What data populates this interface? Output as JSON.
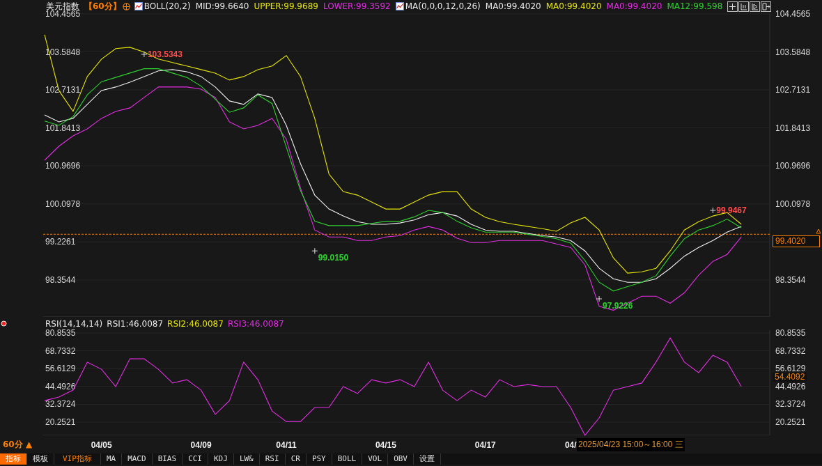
{
  "header": {
    "items": [
      {
        "kind": "title",
        "text": "美元指数",
        "color": "#e8e8e8"
      },
      {
        "kind": "period",
        "text": "【60分】",
        "color": "#ff8000"
      },
      {
        "kind": "add",
        "color": "#ff8000"
      },
      {
        "kind": "indicator",
        "text": "BOLL(20,2)",
        "color": "#e8e8e8"
      },
      {
        "kind": "value",
        "text": "MID:99.6640",
        "color": "#e8e8e8"
      },
      {
        "kind": "value",
        "text": "UPPER:99.9689",
        "color": "#e6e600"
      },
      {
        "kind": "value",
        "text": "LOWER:99.3592",
        "color": "#e22ee2"
      },
      {
        "kind": "indicator",
        "text": "MA(0,0,0,12,0,26)",
        "color": "#e8e8e8"
      },
      {
        "kind": "value",
        "text": "MA0:99.4020",
        "color": "#e8e8e8"
      },
      {
        "kind": "value",
        "text": "MA0:99.4020",
        "color": "#e6e600"
      },
      {
        "kind": "value",
        "text": "MA0:99.4020",
        "color": "#e22ee2"
      },
      {
        "kind": "value",
        "text": "MA12:99.598",
        "color": "#2ed12e"
      }
    ]
  },
  "main": {
    "right_labels": [
      "104.4565",
      "103.5848",
      "102.7131",
      "101.8413",
      "100.9696",
      "100.0978",
      "98.3544"
    ],
    "chart_data": {
      "type": "line",
      "grid": true,
      "categories": [
        null,
        null,
        null,
        null,
        null,
        null,
        null,
        null,
        null,
        null,
        null,
        null,
        null,
        null,
        null,
        null,
        null,
        null,
        null,
        null,
        null,
        null,
        null,
        null,
        null,
        null,
        null,
        null,
        null,
        null,
        null,
        null,
        null,
        null,
        null,
        null,
        null,
        null,
        null,
        null,
        null,
        null,
        null,
        null,
        null,
        null,
        null,
        null,
        null,
        null
      ],
      "ylim": [
        97.505,
        104.488
      ],
      "yticks": [
        {
          "value": 104.4565,
          "label": "104.4565"
        },
        {
          "value": 103.5848,
          "label": "103.5848"
        },
        {
          "value": 102.7131,
          "label": "102.7131"
        },
        {
          "value": 101.8413,
          "label": "101.8413"
        },
        {
          "value": 100.9696,
          "label": "100.9696"
        },
        {
          "value": 100.0978,
          "label": "100.0978"
        },
        {
          "value": 99.2261,
          "label": "99.2261"
        },
        {
          "value": 98.3544,
          "label": "98.3544"
        }
      ],
      "series": [
        {
          "color": "#e6e600",
          "values": [
            103.98,
            102.7,
            102.22,
            103.02,
            103.42,
            103.66,
            103.69,
            103.58,
            103.42,
            103.34,
            103.26,
            103.18,
            103.1,
            102.94,
            103.02,
            103.18,
            103.26,
            103.5,
            103.02,
            102.06,
            100.78,
            100.38,
            100.3,
            100.14,
            99.98,
            99.98,
            100.14,
            100.3,
            100.38,
            100.38,
            99.98,
            99.79,
            99.69,
            99.63,
            99.58,
            99.53,
            99.47,
            99.66,
            99.79,
            99.5,
            98.86,
            98.51,
            98.54,
            98.62,
            99.02,
            99.5,
            99.69,
            99.82,
            99.9,
            99.63
          ]
        },
        {
          "color": "#f0f0f0",
          "values": [
            102.14,
            101.98,
            102.06,
            102.38,
            102.7,
            102.78,
            102.89,
            103.02,
            103.15,
            103.18,
            103.13,
            103.02,
            102.78,
            102.46,
            102.38,
            102.62,
            102.54,
            101.9,
            101.02,
            100.3,
            99.98,
            99.82,
            99.69,
            99.63,
            99.63,
            99.66,
            99.73,
            99.85,
            99.9,
            99.82,
            99.63,
            99.5,
            99.47,
            99.47,
            99.42,
            99.37,
            99.34,
            99.26,
            99.02,
            98.62,
            98.38,
            98.3,
            98.3,
            98.38,
            98.62,
            98.9,
            99.1,
            99.26,
            99.45,
            99.58
          ]
        },
        {
          "color": "#e22ee2",
          "values": [
            101.1,
            101.42,
            101.66,
            101.82,
            102.06,
            102.22,
            102.3,
            102.54,
            102.78,
            102.78,
            102.78,
            102.73,
            102.54,
            101.98,
            101.82,
            101.9,
            102.06,
            101.58,
            100.46,
            99.5,
            99.34,
            99.34,
            99.26,
            99.26,
            99.34,
            99.37,
            99.5,
            99.58,
            99.5,
            99.31,
            99.21,
            99.21,
            99.26,
            99.26,
            99.26,
            99.26,
            99.18,
            99.1,
            98.7,
            97.75,
            97.66,
            97.82,
            97.98,
            97.98,
            97.82,
            98.06,
            98.46,
            98.78,
            98.94,
            99.34
          ]
        },
        {
          "color": "#2ed12e",
          "values": [
            102.0,
            101.9,
            102.1,
            102.6,
            102.9,
            103.0,
            103.1,
            103.2,
            103.2,
            103.1,
            103.0,
            102.8,
            102.5,
            102.2,
            102.3,
            102.6,
            102.4,
            101.4,
            100.4,
            99.7,
            99.6,
            99.6,
            99.6,
            99.65,
            99.7,
            99.7,
            99.8,
            99.95,
            99.9,
            99.7,
            99.55,
            99.45,
            99.45,
            99.45,
            99.4,
            99.35,
            99.3,
            99.2,
            98.8,
            98.3,
            98.1,
            98.2,
            98.3,
            98.45,
            98.9,
            99.3,
            99.5,
            99.6,
            99.75,
            99.55
          ]
        },
        {
          "type": "scatter",
          "color": "#dddddd",
          "values": [
            null,
            null,
            null,
            null,
            null,
            null,
            null,
            103.53,
            null,
            null,
            null,
            null,
            null,
            null,
            null,
            null,
            null,
            null,
            null,
            99.02,
            null,
            null,
            null,
            null,
            null,
            null,
            null,
            null,
            null,
            null,
            null,
            null,
            null,
            null,
            null,
            null,
            null,
            null,
            null,
            97.92,
            null,
            null,
            null,
            null,
            null,
            null,
            null,
            99.95,
            null,
            null
          ]
        }
      ],
      "ref_lines": [
        {
          "axis": "y",
          "value": 99.402,
          "label": "99.4020",
          "color": "#ff8000"
        }
      ],
      "annotations": [
        "103.5343",
        "99.0150",
        "97.9226",
        "99.9467"
      ]
    }
  },
  "rsi": {
    "header": [
      {
        "text": "RSI(14,14,14)",
        "color": "#e8e8e8"
      },
      {
        "text": "RSI1:46.0087",
        "color": "#e8e8e8"
      },
      {
        "text": "RSI2:46.0087",
        "color": "#e6e600"
      },
      {
        "text": "RSI3:46.0087",
        "color": "#e22ee2"
      }
    ],
    "right_labels": [
      "80.8535",
      "68.7332",
      "56.6129",
      "44.4926",
      "32.3724",
      "20.2521"
    ],
    "value_tag": "54.4092",
    "chart_data": {
      "type": "line",
      "grid": true,
      "categories": [
        null,
        null,
        null,
        null,
        "04/05",
        null,
        null,
        null,
        null,
        null,
        null,
        "04/09",
        null,
        null,
        null,
        null,
        null,
        "04/11",
        null,
        null,
        null,
        null,
        null,
        null,
        "04/15",
        null,
        null,
        null,
        null,
        null,
        null,
        "04/17",
        null,
        null,
        null,
        null,
        null,
        "04/",
        null,
        null,
        null,
        null,
        null,
        null,
        null,
        null,
        null,
        null,
        null,
        null
      ],
      "ylim": [
        11.27,
        82.75
      ],
      "yticks": [
        {
          "value": 80.8535,
          "label": "80.8535"
        },
        {
          "value": 68.7332,
          "label": "68.7332"
        },
        {
          "value": 56.6129,
          "label": "56.6129"
        },
        {
          "value": 44.4926,
          "label": "44.4926"
        },
        {
          "value": 32.3724,
          "label": "32.3724"
        },
        {
          "value": 20.2521,
          "label": "20.2521"
        }
      ],
      "series": [
        {
          "color": "#e22ee2",
          "values": [
            34.9,
            37.3,
            42.0,
            61.0,
            56.2,
            44.4,
            63.3,
            63.3,
            56.2,
            46.8,
            49.1,
            42.0,
            25.5,
            34.9,
            61.0,
            49.1,
            27.8,
            20.7,
            20.7,
            30.2,
            30.2,
            44.4,
            39.7,
            49.1,
            46.8,
            49.1,
            44.4,
            61.0,
            42.0,
            34.9,
            42.0,
            37.3,
            49.1,
            44.4,
            45.8,
            44.4,
            44.4,
            30.2,
            11.3,
            23.1,
            42.0,
            44.4,
            46.8,
            61.0,
            77.5,
            61.0,
            53.9,
            65.7,
            61.0,
            44.4
          ]
        }
      ]
    }
  },
  "period_button": "60分 ▲",
  "crosshair_tooltip": "2025/04/23 15:00～16:00 三",
  "toolbar": [
    {
      "label": "指标",
      "kind": "plain",
      "selected": true
    },
    {
      "label": "模板",
      "kind": "plain",
      "selected": false
    },
    {
      "label": "VIP指标",
      "kind": "vip",
      "selected": false
    },
    {
      "label": "MA",
      "kind": "plain",
      "selected": false
    },
    {
      "label": "MACD",
      "kind": "plain",
      "selected": false
    },
    {
      "label": "BIAS",
      "kind": "plain",
      "selected": false
    },
    {
      "label": "CCI",
      "kind": "plain",
      "selected": false
    },
    {
      "label": "KDJ",
      "kind": "plain",
      "selected": false
    },
    {
      "label": "LW&",
      "kind": "plain",
      "selected": false
    },
    {
      "label": "RSI",
      "kind": "plain",
      "selected": false
    },
    {
      "label": "CR",
      "kind": "plain",
      "selected": false
    },
    {
      "label": "PSY",
      "kind": "plain",
      "selected": false
    },
    {
      "label": "BOLL",
      "kind": "plain",
      "selected": false
    },
    {
      "label": "VOL",
      "kind": "plain",
      "selected": false
    },
    {
      "label": "OBV",
      "kind": "plain",
      "selected": false
    },
    {
      "label": "设置",
      "kind": "plain",
      "selected": false
    }
  ]
}
